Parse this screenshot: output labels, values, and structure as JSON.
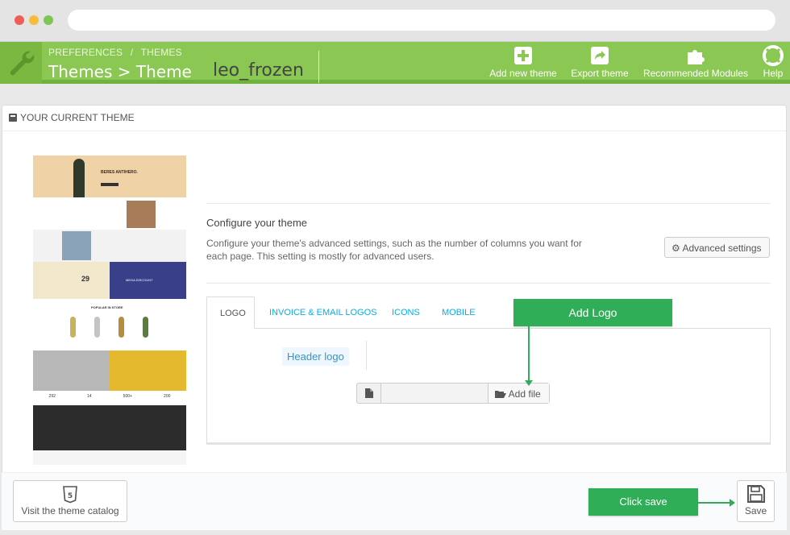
{
  "breadcrumb": [
    "PREFERENCES",
    "/",
    "THEMES"
  ],
  "page_title": "Themes > Theme",
  "toolbar": [
    {
      "label": "Add new theme",
      "icon": "plus-square-icon"
    },
    {
      "label": "Export theme",
      "icon": "share-icon"
    },
    {
      "label": "Recommended Modules",
      "icon": "puzzle-icon"
    },
    {
      "label": "Help",
      "icon": "lifebuoy-icon"
    }
  ],
  "panel": {
    "heading": "YOUR CURRENT THEME"
  },
  "theme_name": "leo_frozen",
  "preview": {
    "hero_title": "BERES ANTIHERO.",
    "sale_value": "29",
    "sale_right": "MEGA DISCOUNT",
    "section_title": "POPULAR IN STORE",
    "stats": [
      "292",
      "14",
      "500+",
      "200"
    ]
  },
  "configure": {
    "title": "Configure your theme",
    "description": "Configure your theme's advanced settings, such as the number of columns you want for each page. This setting is mostly for advanced users.",
    "advanced_button": "Advanced settings"
  },
  "tabs": [
    {
      "label": "LOGO",
      "active": true
    },
    {
      "label": "INVOICE & EMAIL LOGOS",
      "active": false
    },
    {
      "label": "ICONS",
      "active": false
    },
    {
      "label": "MOBILE",
      "active": false
    }
  ],
  "logo_tab": {
    "header_logo_label": "Header logo",
    "add_file_button": "Add file"
  },
  "annotations": {
    "add_logo": "Add Logo",
    "click_save": "Click save"
  },
  "footer": {
    "catalog_button": "Visit the theme catalog",
    "save_button": "Save"
  },
  "colors": {
    "header_green": "#8ac853",
    "annotation_green": "#2fae57",
    "link_blue": "#00aff0"
  }
}
